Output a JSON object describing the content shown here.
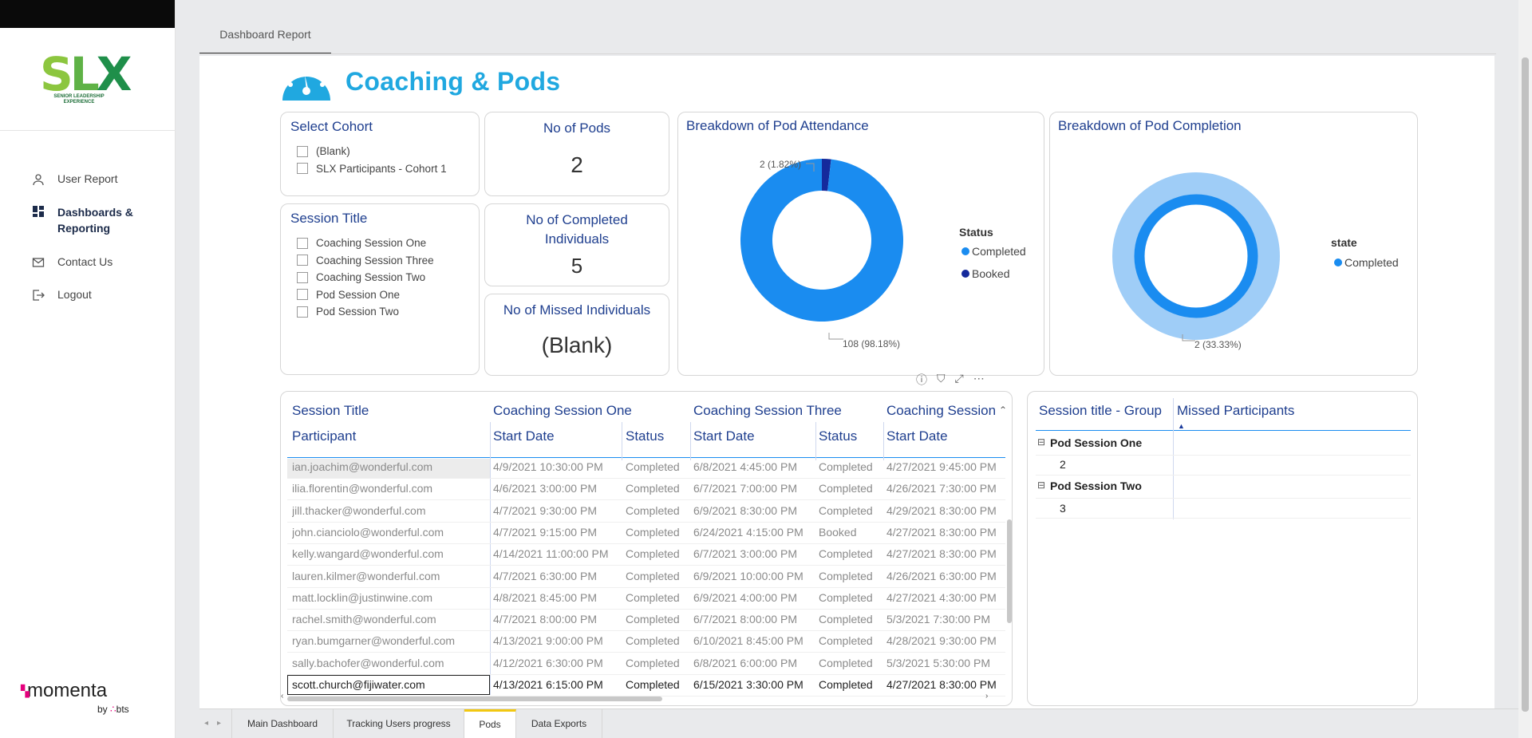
{
  "sidebar": {
    "logo_text": "SLX",
    "logo_subtext": "SENIOR LEADERSHIP EXPERIENCE",
    "items": [
      {
        "label": "User Report",
        "icon": "user-icon"
      },
      {
        "label": "Dashboards & Reporting",
        "icon": "dashboard-icon",
        "active": true
      },
      {
        "label": "Contact Us",
        "icon": "mail-icon"
      },
      {
        "label": "Logout",
        "icon": "logout-icon"
      }
    ],
    "brand": {
      "name": "momenta",
      "by": "by",
      "partner": "bts"
    }
  },
  "header": {
    "tab_label": "Dashboard Report"
  },
  "report": {
    "title": "Coaching & Pods",
    "cohort_slicer": {
      "title": "Select Cohort",
      "options": [
        "(Blank)",
        "SLX Participants - Cohort 1"
      ]
    },
    "session_slicer": {
      "title": "Session Title",
      "options": [
        "Coaching Session One",
        "Coaching Session Three",
        "Coaching Session Two",
        "Pod Session One",
        "Pod Session Two"
      ]
    },
    "kpi_pods": {
      "title": "No of Pods",
      "value": "2"
    },
    "kpi_completed": {
      "title": "No of Completed Individuals",
      "value": "5"
    },
    "kpi_missed": {
      "title": "No of Missed Individuals",
      "value": "(Blank)"
    },
    "attendance": {
      "title": "Breakdown of Pod Attendance",
      "legend_title": "Status",
      "label_booked": "2 (1.82%)",
      "label_completed": "108 (98.18%)"
    },
    "completion": {
      "title": "Breakdown of Pod Completion",
      "legend_title": "state",
      "label": "2 (33.33%)"
    },
    "matrix": {
      "groups": [
        "Session Title",
        "Coaching Session One",
        "Coaching Session Three",
        "Coaching Session"
      ],
      "columns": [
        "Participant",
        "Start Date",
        "Status",
        "Start Date",
        "Status",
        "Start Date"
      ],
      "rows": [
        [
          "ian.joachim@wonderful.com",
          "4/9/2021 10:30:00 PM",
          "Completed",
          "6/8/2021 4:45:00 PM",
          "Completed",
          "4/27/2021 9:45:00 PM"
        ],
        [
          "ilia.florentin@wonderful.com",
          "4/6/2021 3:00:00 PM",
          "Completed",
          "6/7/2021 7:00:00 PM",
          "Completed",
          "4/26/2021 7:30:00 PM"
        ],
        [
          "jill.thacker@wonderful.com",
          "4/7/2021 9:30:00 PM",
          "Completed",
          "6/9/2021 8:30:00 PM",
          "Completed",
          "4/29/2021 8:30:00 PM"
        ],
        [
          "john.cianciolo@wonderful.com",
          "4/7/2021 9:15:00 PM",
          "Completed",
          "6/24/2021 4:15:00 PM",
          "Booked",
          "4/27/2021 8:30:00 PM"
        ],
        [
          "kelly.wangard@wonderful.com",
          "4/14/2021 11:00:00 PM",
          "Completed",
          "6/7/2021 3:00:00 PM",
          "Completed",
          "4/27/2021 8:30:00 PM"
        ],
        [
          "lauren.kilmer@wonderful.com",
          "4/7/2021 6:30:00 PM",
          "Completed",
          "6/9/2021 10:00:00 PM",
          "Completed",
          "4/26/2021 6:30:00 PM"
        ],
        [
          "matt.locklin@justinwine.com",
          "4/8/2021 8:45:00 PM",
          "Completed",
          "6/9/2021 4:00:00 PM",
          "Completed",
          "4/27/2021 4:30:00 PM"
        ],
        [
          "rachel.smith@wonderful.com",
          "4/7/2021 8:00:00 PM",
          "Completed",
          "6/7/2021 8:00:00 PM",
          "Completed",
          "5/3/2021 7:30:00 PM"
        ],
        [
          "ryan.bumgarner@wonderful.com",
          "4/13/2021 9:00:00 PM",
          "Completed",
          "6/10/2021 8:45:00 PM",
          "Completed",
          "4/28/2021 9:30:00 PM"
        ],
        [
          "sally.bachofer@wonderful.com",
          "4/12/2021 6:30:00 PM",
          "Completed",
          "6/8/2021 6:00:00 PM",
          "Completed",
          "5/3/2021 5:30:00 PM"
        ],
        [
          "scott.church@fijiwater.com",
          "4/13/2021 6:15:00 PM",
          "Completed",
          "6/15/2021 3:30:00 PM",
          "Completed",
          "4/27/2021 8:30:00 PM"
        ]
      ]
    },
    "missed": {
      "col1": "Session title - Group",
      "col2": "Missed Participants",
      "groups": [
        {
          "label": "Pod Session One",
          "value": "2"
        },
        {
          "label": "Pod Session Two",
          "value": "3"
        }
      ]
    }
  },
  "page_tabs": [
    "Main Dashboard",
    "Tracking Users progress",
    "Pods",
    "Data Exports"
  ],
  "active_page_tab": "Pods",
  "colors": {
    "completed": "#1a8cf0",
    "booked": "#152a9c",
    "completion_outer": "#9fcdf7",
    "title_blue": "#20a8e0"
  },
  "chart_data": [
    {
      "type": "pie",
      "title": "Breakdown of Pod Attendance",
      "legend_title": "Status",
      "categories": [
        "Completed",
        "Booked"
      ],
      "values": [
        108,
        2
      ],
      "percents": [
        98.18,
        1.82
      ]
    },
    {
      "type": "pie",
      "title": "Breakdown of Pod Completion",
      "legend_title": "state",
      "categories": [
        "Completed"
      ],
      "values": [
        2
      ],
      "percents": [
        33.33
      ]
    }
  ]
}
